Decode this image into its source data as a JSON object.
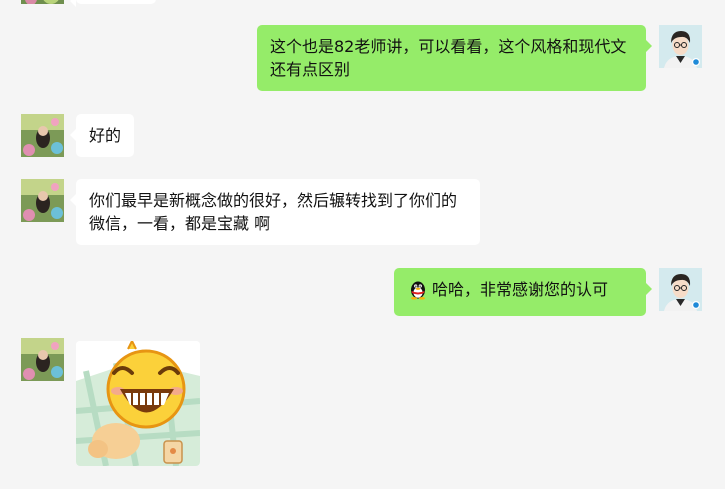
{
  "messages": [
    {
      "side": "out",
      "text": "这个也是82老师讲，可以看看，这个风格和现代文还有点区别"
    },
    {
      "side": "in",
      "text": "好的"
    },
    {
      "side": "in",
      "text": "你们最早是新概念做的很好，然后辗转找到了你们的微信，一看，都是宝藏 啊"
    },
    {
      "side": "out",
      "emoji": "qq-penguin-icon",
      "text": "哈哈，非常感谢您的认可"
    },
    {
      "side": "in",
      "sticker": "laughing-face-sticker"
    }
  ],
  "colors": {
    "background": "#f5f5f5",
    "incoming_bubble": "#ffffff",
    "outgoing_bubble": "#95ec69"
  }
}
